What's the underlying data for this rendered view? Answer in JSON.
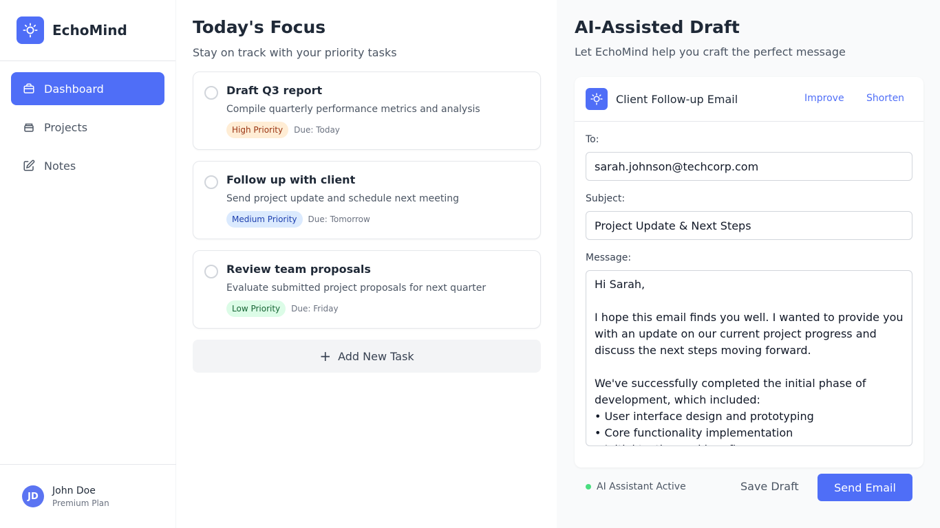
{
  "app": {
    "name": "EchoMind",
    "logo_icon": "lightbulb-icon"
  },
  "sidebar": {
    "items": [
      {
        "label": "Dashboard",
        "icon": "briefcase-icon",
        "active": true
      },
      {
        "label": "Projects",
        "icon": "folder-icon",
        "active": false
      },
      {
        "label": "Notes",
        "icon": "edit-icon",
        "active": false
      }
    ]
  },
  "user": {
    "initials": "JD",
    "name": "John Doe",
    "plan": "Premium Plan"
  },
  "main": {
    "title": "Today's Focus",
    "subtitle": "Stay on track with your priority tasks",
    "tasks": [
      {
        "title": "Draft Q3 report",
        "description": "Compile quarterly performance metrics and analysis",
        "priority": "High Priority",
        "due": "Due: Today"
      },
      {
        "title": "Follow up with client",
        "description": "Send project update and schedule next meeting",
        "priority": "Medium Priority",
        "due": "Due: Tomorrow"
      },
      {
        "title": "Review team proposals",
        "description": "Evaluate submitted project proposals for next quarter",
        "priority": "Low Priority",
        "due": "Due: Friday"
      }
    ],
    "add_task_label": "Add New Task"
  },
  "draft": {
    "title": "AI-Assisted Draft",
    "subtitle": "Let EchoMind help you craft the perfect message",
    "card_title": "Client Follow-up Email",
    "improve_label": "Improve",
    "shorten_label": "Shorten",
    "to_label": "To:",
    "to_value": "sarah.johnson@techcorp.com",
    "subject_label": "Subject:",
    "subject_value": "Project Update & Next Steps",
    "message_label": "Message:",
    "message_value": "Hi Sarah,\n\nI hope this email finds you well. I wanted to provide you with an update on our current project progress and discuss the next steps moving forward.\n\nWe've successfully completed the initial phase of development, which included:\n• User interface design and prototyping\n• Core functionality implementation\n• Initial testing and bug fixes",
    "status": "AI Assistant Active",
    "save_label": "Save Draft",
    "send_label": "Send Email"
  },
  "colors": {
    "accent": "#4f6ef7",
    "high_priority_bg": "#ffedd5",
    "medium_priority_bg": "#dbeafe",
    "low_priority_bg": "#dcfce7",
    "status_dot": "#4ade80"
  }
}
